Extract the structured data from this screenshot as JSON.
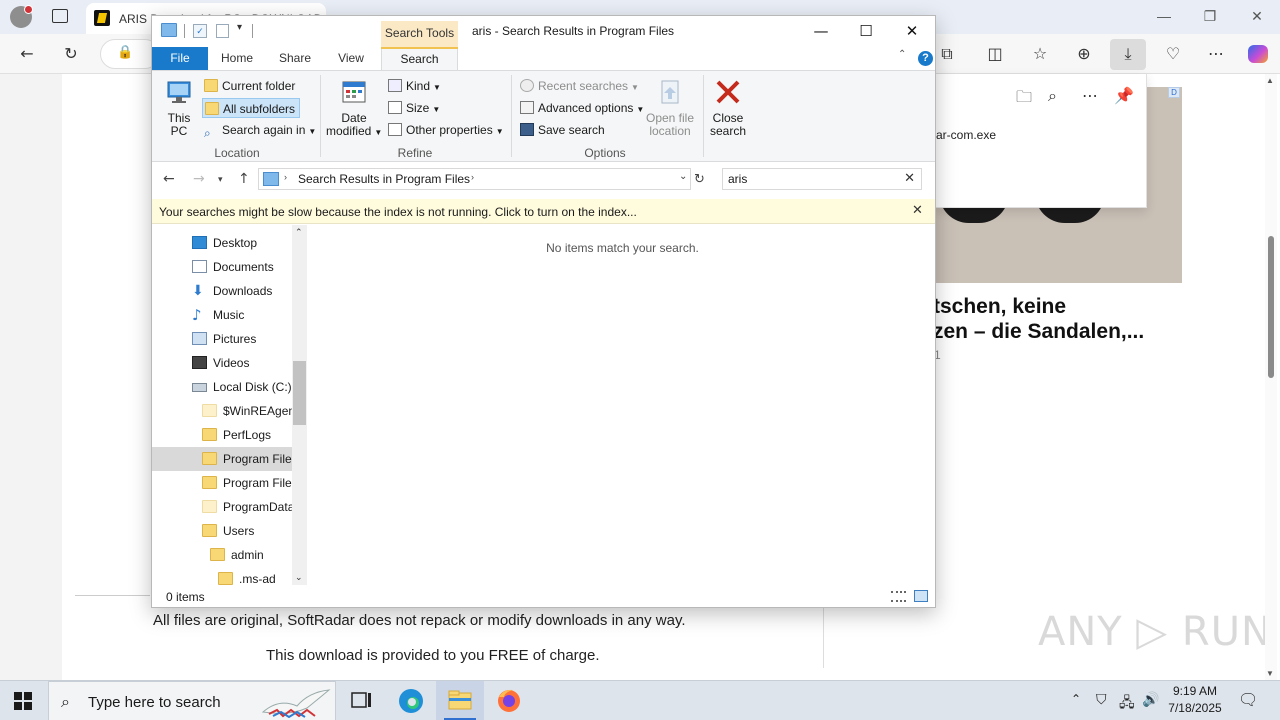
{
  "browser": {
    "tab_title": "ARIS Download for PC - DOWNLOAD",
    "downloads_flyout": {
      "filename": "ar-com.exe"
    },
    "page": {
      "headline": "tschen, keine\nzen – die Sandalen,...",
      "headline_meta": "1",
      "ad_badge": "D",
      "line_1": "All files are original, SoftRadar does not repack or modify downloads in any way.",
      "line_2": "This download is provided to you FREE of charge."
    },
    "watermark": "ANY ▷ RUN"
  },
  "explorer": {
    "context_tab": "Search Tools",
    "window_title": "aris - Search Results in Program Files",
    "tabs": [
      "File",
      "Home",
      "Share",
      "View",
      "Search"
    ],
    "ribbon": {
      "location": {
        "label": "Location",
        "this_pc": "This PC",
        "current_folder": "Current folder",
        "all_subfolders": "All subfolders",
        "search_again_in": "Search again in"
      },
      "refine": {
        "label": "Refine",
        "date_modified_1": "Date",
        "date_modified_2": "modified",
        "kind": "Kind",
        "size": "Size",
        "other_properties": "Other properties"
      },
      "options": {
        "label": "Options",
        "recent_searches": "Recent searches",
        "advanced_options": "Advanced options",
        "save_search": "Save search",
        "open_file_location_1": "Open file",
        "open_file_location_2": "location"
      },
      "close": {
        "line1": "Close",
        "line2": "search"
      }
    },
    "address": {
      "path": "Search Results in Program Files"
    },
    "search": {
      "value": "aris"
    },
    "infobar": "Your searches might be slow because the index is not running.  Click to turn on the index...",
    "nav_tree": [
      {
        "label": "Desktop",
        "icon": "desktop-icon"
      },
      {
        "label": "Documents",
        "icon": "documents-icon"
      },
      {
        "label": "Downloads",
        "icon": "downloads-icon"
      },
      {
        "label": "Music",
        "icon": "music-icon"
      },
      {
        "label": "Pictures",
        "icon": "pictures-icon"
      },
      {
        "label": "Videos",
        "icon": "videos-icon"
      },
      {
        "label": "Local Disk (C:)",
        "icon": "disk-icon"
      },
      {
        "label": "$WinREAgent",
        "icon": "folder-icon"
      },
      {
        "label": "PerfLogs",
        "icon": "folder-icon"
      },
      {
        "label": "Program Files",
        "icon": "folder-icon",
        "selected": true
      },
      {
        "label": "Program Files",
        "icon": "folder-icon"
      },
      {
        "label": "ProgramData",
        "icon": "folder-icon"
      },
      {
        "label": "Users",
        "icon": "folder-icon"
      },
      {
        "label": "admin",
        "icon": "folder-icon"
      },
      {
        "label": ".ms-ad",
        "icon": "folder-icon"
      }
    ],
    "empty_message": "No items match your search.",
    "status": {
      "item_count": "0 items"
    }
  },
  "taskbar": {
    "search_placeholder": "Type here to search",
    "time": "9:19 AM",
    "date": "7/18/2025"
  },
  "colors": {
    "file_tab": "#1979ca",
    "context_tab": "#fbe9c6",
    "infobar": "#fffbdd",
    "close_search": "#c42b1c",
    "selected_tree_item": "#d9d9d9"
  }
}
